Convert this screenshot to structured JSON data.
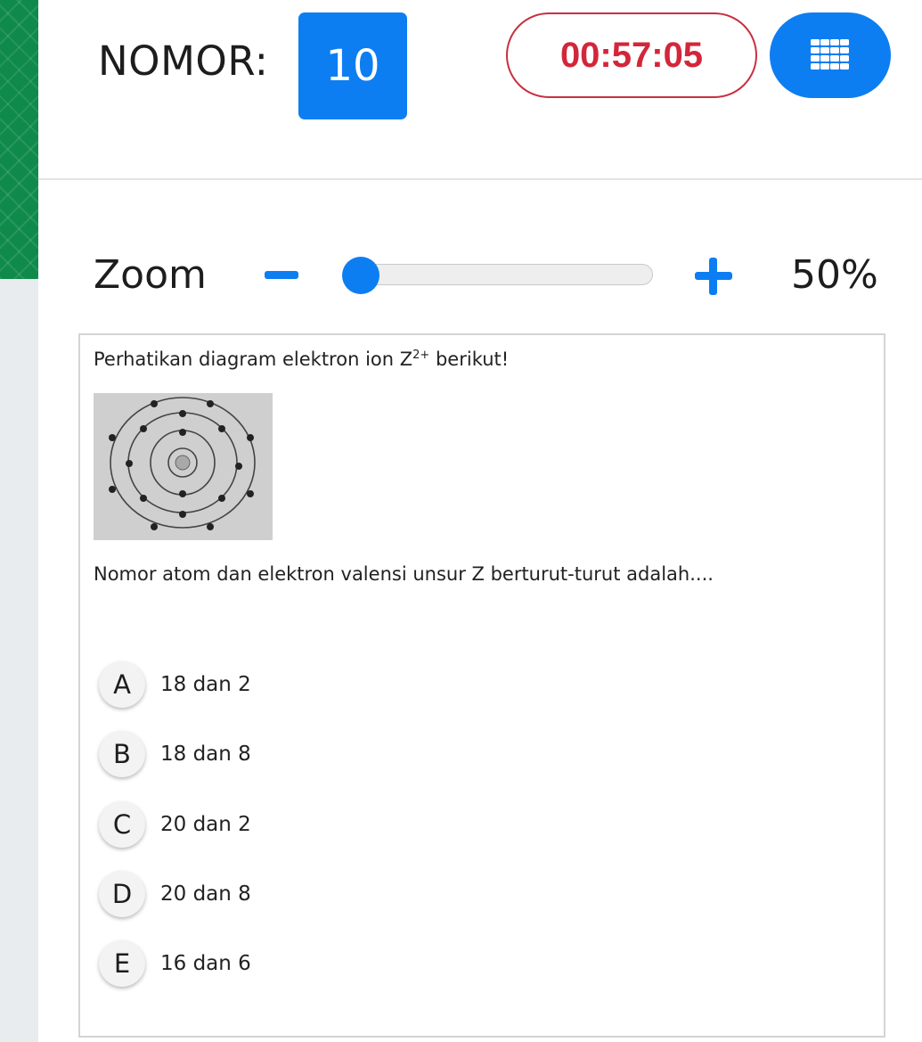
{
  "header": {
    "question_label": "NOMOR:",
    "question_number": "10",
    "timer": "00:57:05",
    "question_grid_icon": "grid-menu-icon"
  },
  "zoom": {
    "label": "Zoom",
    "minus_icon": "minus-icon",
    "plus_icon": "plus-icon",
    "value_text": "50%",
    "slider_level": 0.0
  },
  "question": {
    "intro_before": "Perhatikan diagram elektron ion Z",
    "intro_sup": "2+",
    "intro_after": " berikut!",
    "body": "Nomor atom dan elektron valensi unsur Z berturut-turut adalah...."
  },
  "options": [
    {
      "letter": "A",
      "text": "18 dan 2"
    },
    {
      "letter": "B",
      "text": "18 dan 8"
    },
    {
      "letter": "C",
      "text": "20 dan 2"
    },
    {
      "letter": "D",
      "text": "20 dan 8"
    },
    {
      "letter": "E",
      "text": "16 dan 6"
    }
  ],
  "colors": {
    "accent": "#0d7ef2",
    "timer": "#d3263a",
    "rail": "#0f8a4a"
  }
}
